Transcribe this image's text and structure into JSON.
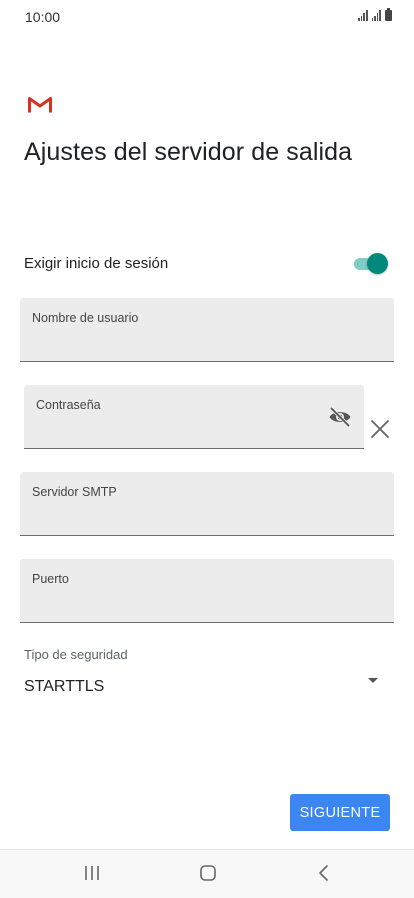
{
  "status_bar": {
    "time": "10:00"
  },
  "app": {
    "logo_icon": "gmail-logo-icon",
    "brand_color": "#d93025"
  },
  "page": {
    "title": "Ajustes del servidor de salida"
  },
  "signin_toggle": {
    "label": "Exigir inicio de sesión",
    "enabled": true,
    "accent_color": "#00897b"
  },
  "fields": {
    "username": {
      "label": "Nombre de usuario",
      "value": ""
    },
    "password": {
      "label": "Contraseña",
      "value": "",
      "visibility_icon": "eye-off-icon"
    },
    "smtp_server": {
      "label": "Servidor SMTP",
      "value": ""
    },
    "port": {
      "label": "Puerto",
      "value": ""
    }
  },
  "security": {
    "label": "Tipo de seguridad",
    "selected": "STARTTLS"
  },
  "actions": {
    "next_label": "SIGUIENTE",
    "next_color": "#3b86f0"
  },
  "nav_bar": {
    "recents_icon": "recents-icon",
    "home_icon": "home-icon",
    "back_icon": "back-icon"
  }
}
